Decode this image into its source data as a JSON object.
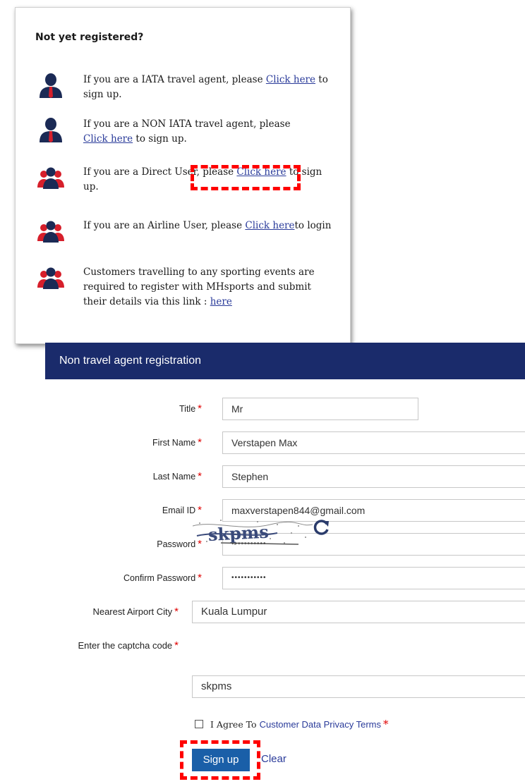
{
  "signup_options": {
    "title": "Not yet registered?",
    "items": [
      {
        "pre": "If you are a IATA travel agent, please ",
        "link": "Click here",
        "post": " to sign up."
      },
      {
        "pre": "If you are a NON IATA travel agent, please ",
        "link": "Click here",
        "post": " to sign up."
      },
      {
        "pre": "If you are a Direct User, please ",
        "link": "Click here",
        "post": " to sign up."
      },
      {
        "pre": "If you are an Airline User, please ",
        "link": "Click here",
        "post": "to login"
      },
      {
        "pre": "Customers travelling to any sporting events are required to register with MHsports and submit their details via this link : ",
        "link": "here",
        "post": ""
      }
    ]
  },
  "registration": {
    "header": "Non travel agent registration",
    "fields": {
      "title": {
        "label": "Title",
        "value": "Mr"
      },
      "first_name": {
        "label": "First Name",
        "value": "Verstapen Max"
      },
      "last_name": {
        "label": "Last Name",
        "value": "Stephen"
      },
      "email": {
        "label": "Email ID",
        "value": "maxverstapen844@gmail.com"
      },
      "password": {
        "label": "Password",
        "value": "•••••••••••"
      },
      "confirm_password": {
        "label": "Confirm Password",
        "value": "•••••••••••"
      },
      "airport_city": {
        "label": "Nearest Airport City",
        "value": "Kuala Lumpur"
      },
      "captcha": {
        "label": "Enter the captcha code",
        "value": "skpms"
      }
    },
    "required_mark": "*",
    "agree_text": "I Agree To",
    "agree_link": "Customer Data Privacy Terms",
    "signup_label": "Sign up",
    "clear_label": "Clear"
  },
  "colors": {
    "header_bg": "#1a2b6b",
    "link": "#2a3b9a",
    "required": "#e00000",
    "button": "#1a5fa8",
    "highlight": "#ff0000"
  }
}
